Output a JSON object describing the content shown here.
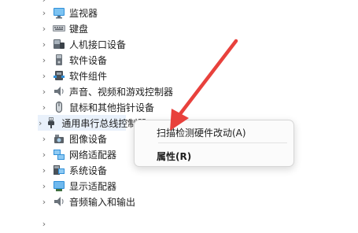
{
  "tree_items": [
    {
      "label": "监视器",
      "icon": "monitor-icon"
    },
    {
      "label": "键盘",
      "icon": "keyboard-icon"
    },
    {
      "label": "人机接口设备",
      "icon": "hid-icon"
    },
    {
      "label": "软件设备",
      "icon": "software-device-icon"
    },
    {
      "label": "软件组件",
      "icon": "software-component-icon"
    },
    {
      "label": "声音、视频和游戏控制器",
      "icon": "speaker-icon"
    },
    {
      "label": "鼠标和其他指针设备",
      "icon": "mouse-icon"
    },
    {
      "label": "通用串行总线控制器",
      "icon": "usb-icon"
    },
    {
      "label": "图像设备",
      "icon": "camera-icon"
    },
    {
      "label": "网络适配器",
      "icon": "network-adapter-icon"
    },
    {
      "label": "系统设备",
      "icon": "system-device-icon"
    },
    {
      "label": "显示适配器",
      "icon": "display-adapter-icon"
    },
    {
      "label": "音频输入和输出",
      "icon": "audio-io-icon"
    }
  ],
  "context_menu": {
    "scan_label": "扫描检测硬件改动(A)",
    "properties_label": "属性(R)"
  },
  "colors": {
    "annotation_arrow": "#e8413c",
    "selection_highlight": "#e9f1fb"
  }
}
